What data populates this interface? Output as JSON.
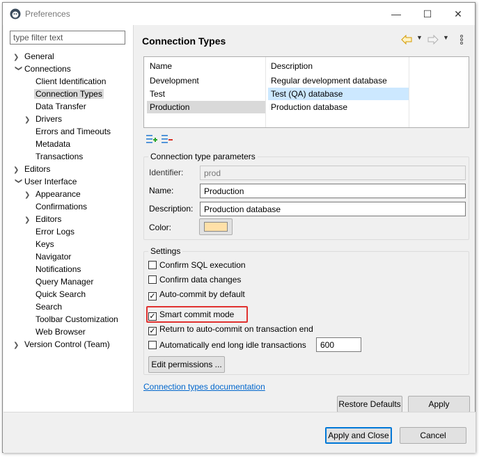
{
  "window": {
    "title": "Preferences",
    "minimize": "—",
    "maximize": "☐",
    "close": "✕"
  },
  "filter": {
    "placeholder": "type filter text"
  },
  "tree": {
    "general": "General",
    "connections": "Connections",
    "client_identification": "Client Identification",
    "connection_types": "Connection Types",
    "data_transfer": "Data Transfer",
    "drivers": "Drivers",
    "errors_timeouts": "Errors and Timeouts",
    "metadata": "Metadata",
    "transactions": "Transactions",
    "editors": "Editors",
    "user_interface": "User Interface",
    "appearance": "Appearance",
    "confirmations": "Confirmations",
    "ui_editors": "Editors",
    "error_logs": "Error Logs",
    "keys": "Keys",
    "navigator": "Navigator",
    "notifications": "Notifications",
    "query_manager": "Query Manager",
    "quick_search": "Quick Search",
    "search": "Search",
    "toolbar_customization": "Toolbar Customization",
    "web_browser": "Web Browser",
    "version_control": "Version Control (Team)"
  },
  "page": {
    "title": "Connection Types"
  },
  "table": {
    "col_name": "Name",
    "col_description": "Description",
    "rows": [
      {
        "name": "Development",
        "description": "Regular development database"
      },
      {
        "name": "Test",
        "description": "Test (QA) database"
      },
      {
        "name": "Production",
        "description": "Production database"
      }
    ]
  },
  "params": {
    "title": "Connection type parameters",
    "identifier_label": "Identifier:",
    "identifier_value": "prod",
    "name_label": "Name:",
    "name_value": "Production",
    "description_label": "Description:",
    "description_value": "Production database",
    "color_label": "Color:",
    "color_value": "#ffe0a8"
  },
  "settings": {
    "title": "Settings",
    "confirm_sql": "Confirm SQL execution",
    "confirm_data": "Confirm data changes",
    "auto_commit": "Auto-commit by default",
    "smart_commit": "Smart commit mode",
    "return_auto_commit": "Return to auto-commit on transaction end",
    "auto_end_idle": "Automatically end long idle transactions",
    "idle_value": "600",
    "edit_permissions": "Edit permissions ..."
  },
  "link": {
    "docs": "Connection types documentation"
  },
  "buttons": {
    "restore_defaults": "Restore Defaults",
    "apply": "Apply",
    "apply_close": "Apply and Close",
    "cancel": "Cancel"
  },
  "colors": {
    "selection": "#cce8ff",
    "highlight": "#e0312f",
    "link": "#0066cc"
  }
}
